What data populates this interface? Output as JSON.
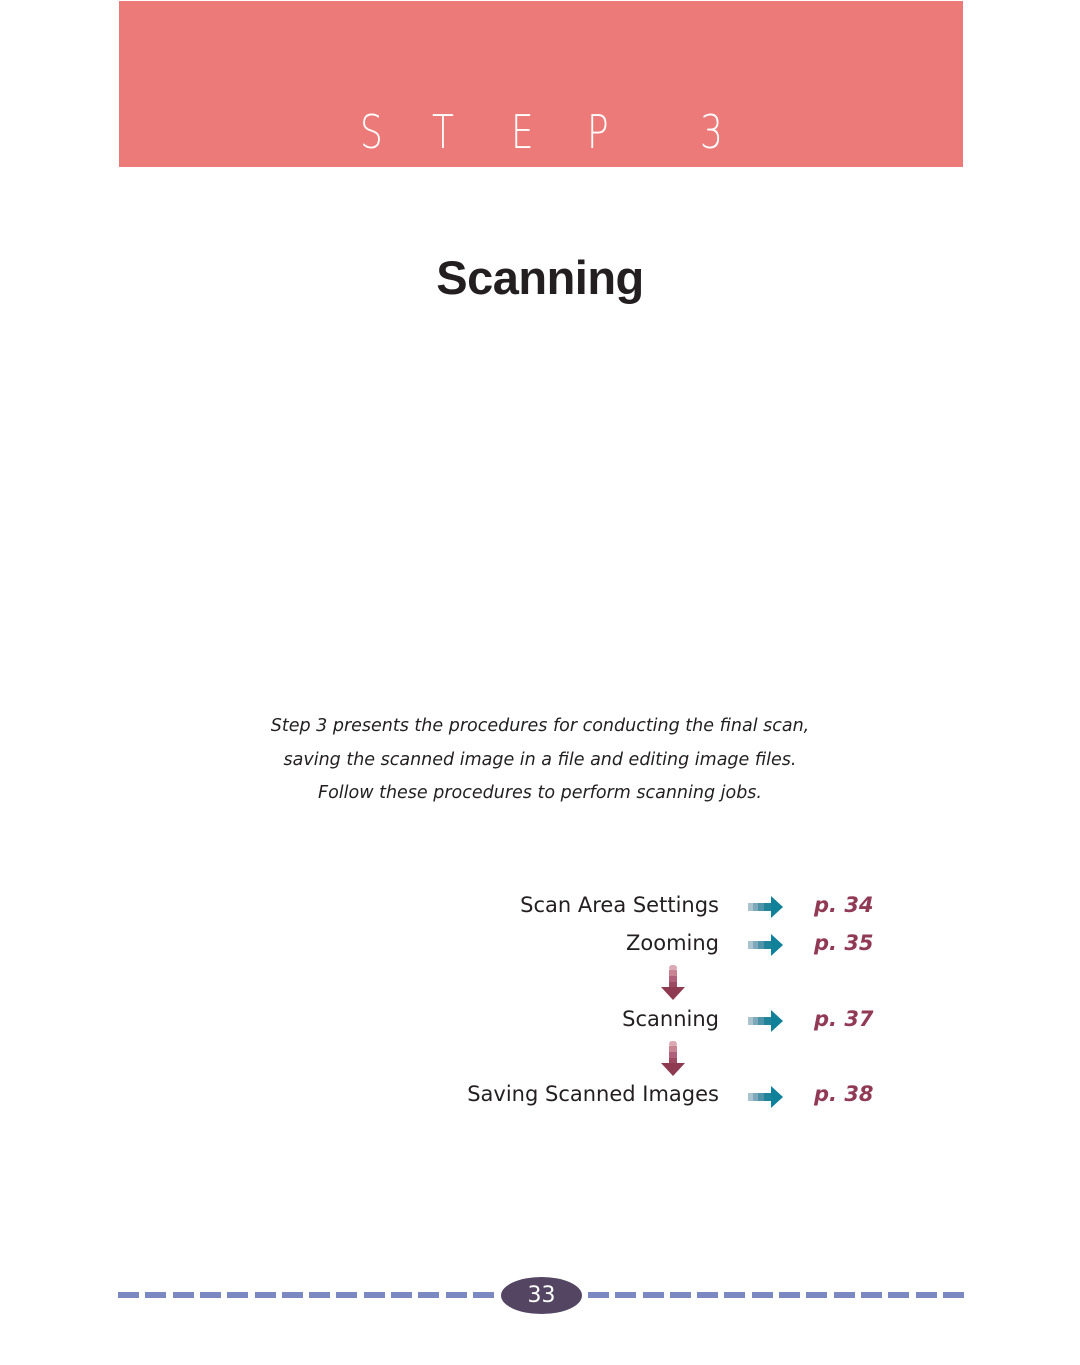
{
  "header": {
    "step_letters": [
      "S",
      "T",
      "E",
      "P",
      "3"
    ],
    "banner_color": "#ec7a78"
  },
  "title": "Scanning",
  "intro": {
    "lines": [
      "Step 3 presents the procedures for conducting the final scan,",
      "saving the scanned image in a file and editing image files.",
      "Follow these procedures to perform scanning jobs."
    ]
  },
  "flow": {
    "items": [
      {
        "label": "Scan Area Settings",
        "page_ref": "p. 34",
        "icon": "arrow-right-icon"
      },
      {
        "label": "Zooming",
        "page_ref": "p. 35",
        "icon": "arrow-right-icon"
      },
      {
        "label": "Scanning",
        "page_ref": "p. 37",
        "icon": "arrow-right-icon"
      },
      {
        "label": "Saving Scanned Images",
        "page_ref": "p. 38",
        "icon": "arrow-right-icon"
      }
    ],
    "connector_icon": "arrow-down-icon",
    "arrow_color": "#11819a",
    "down_arrow_color": "#8e3a50",
    "page_ref_color": "#913a56"
  },
  "footer": {
    "page_number": "33",
    "dash_color": "#7b88c2",
    "badge_color": "#544663"
  }
}
